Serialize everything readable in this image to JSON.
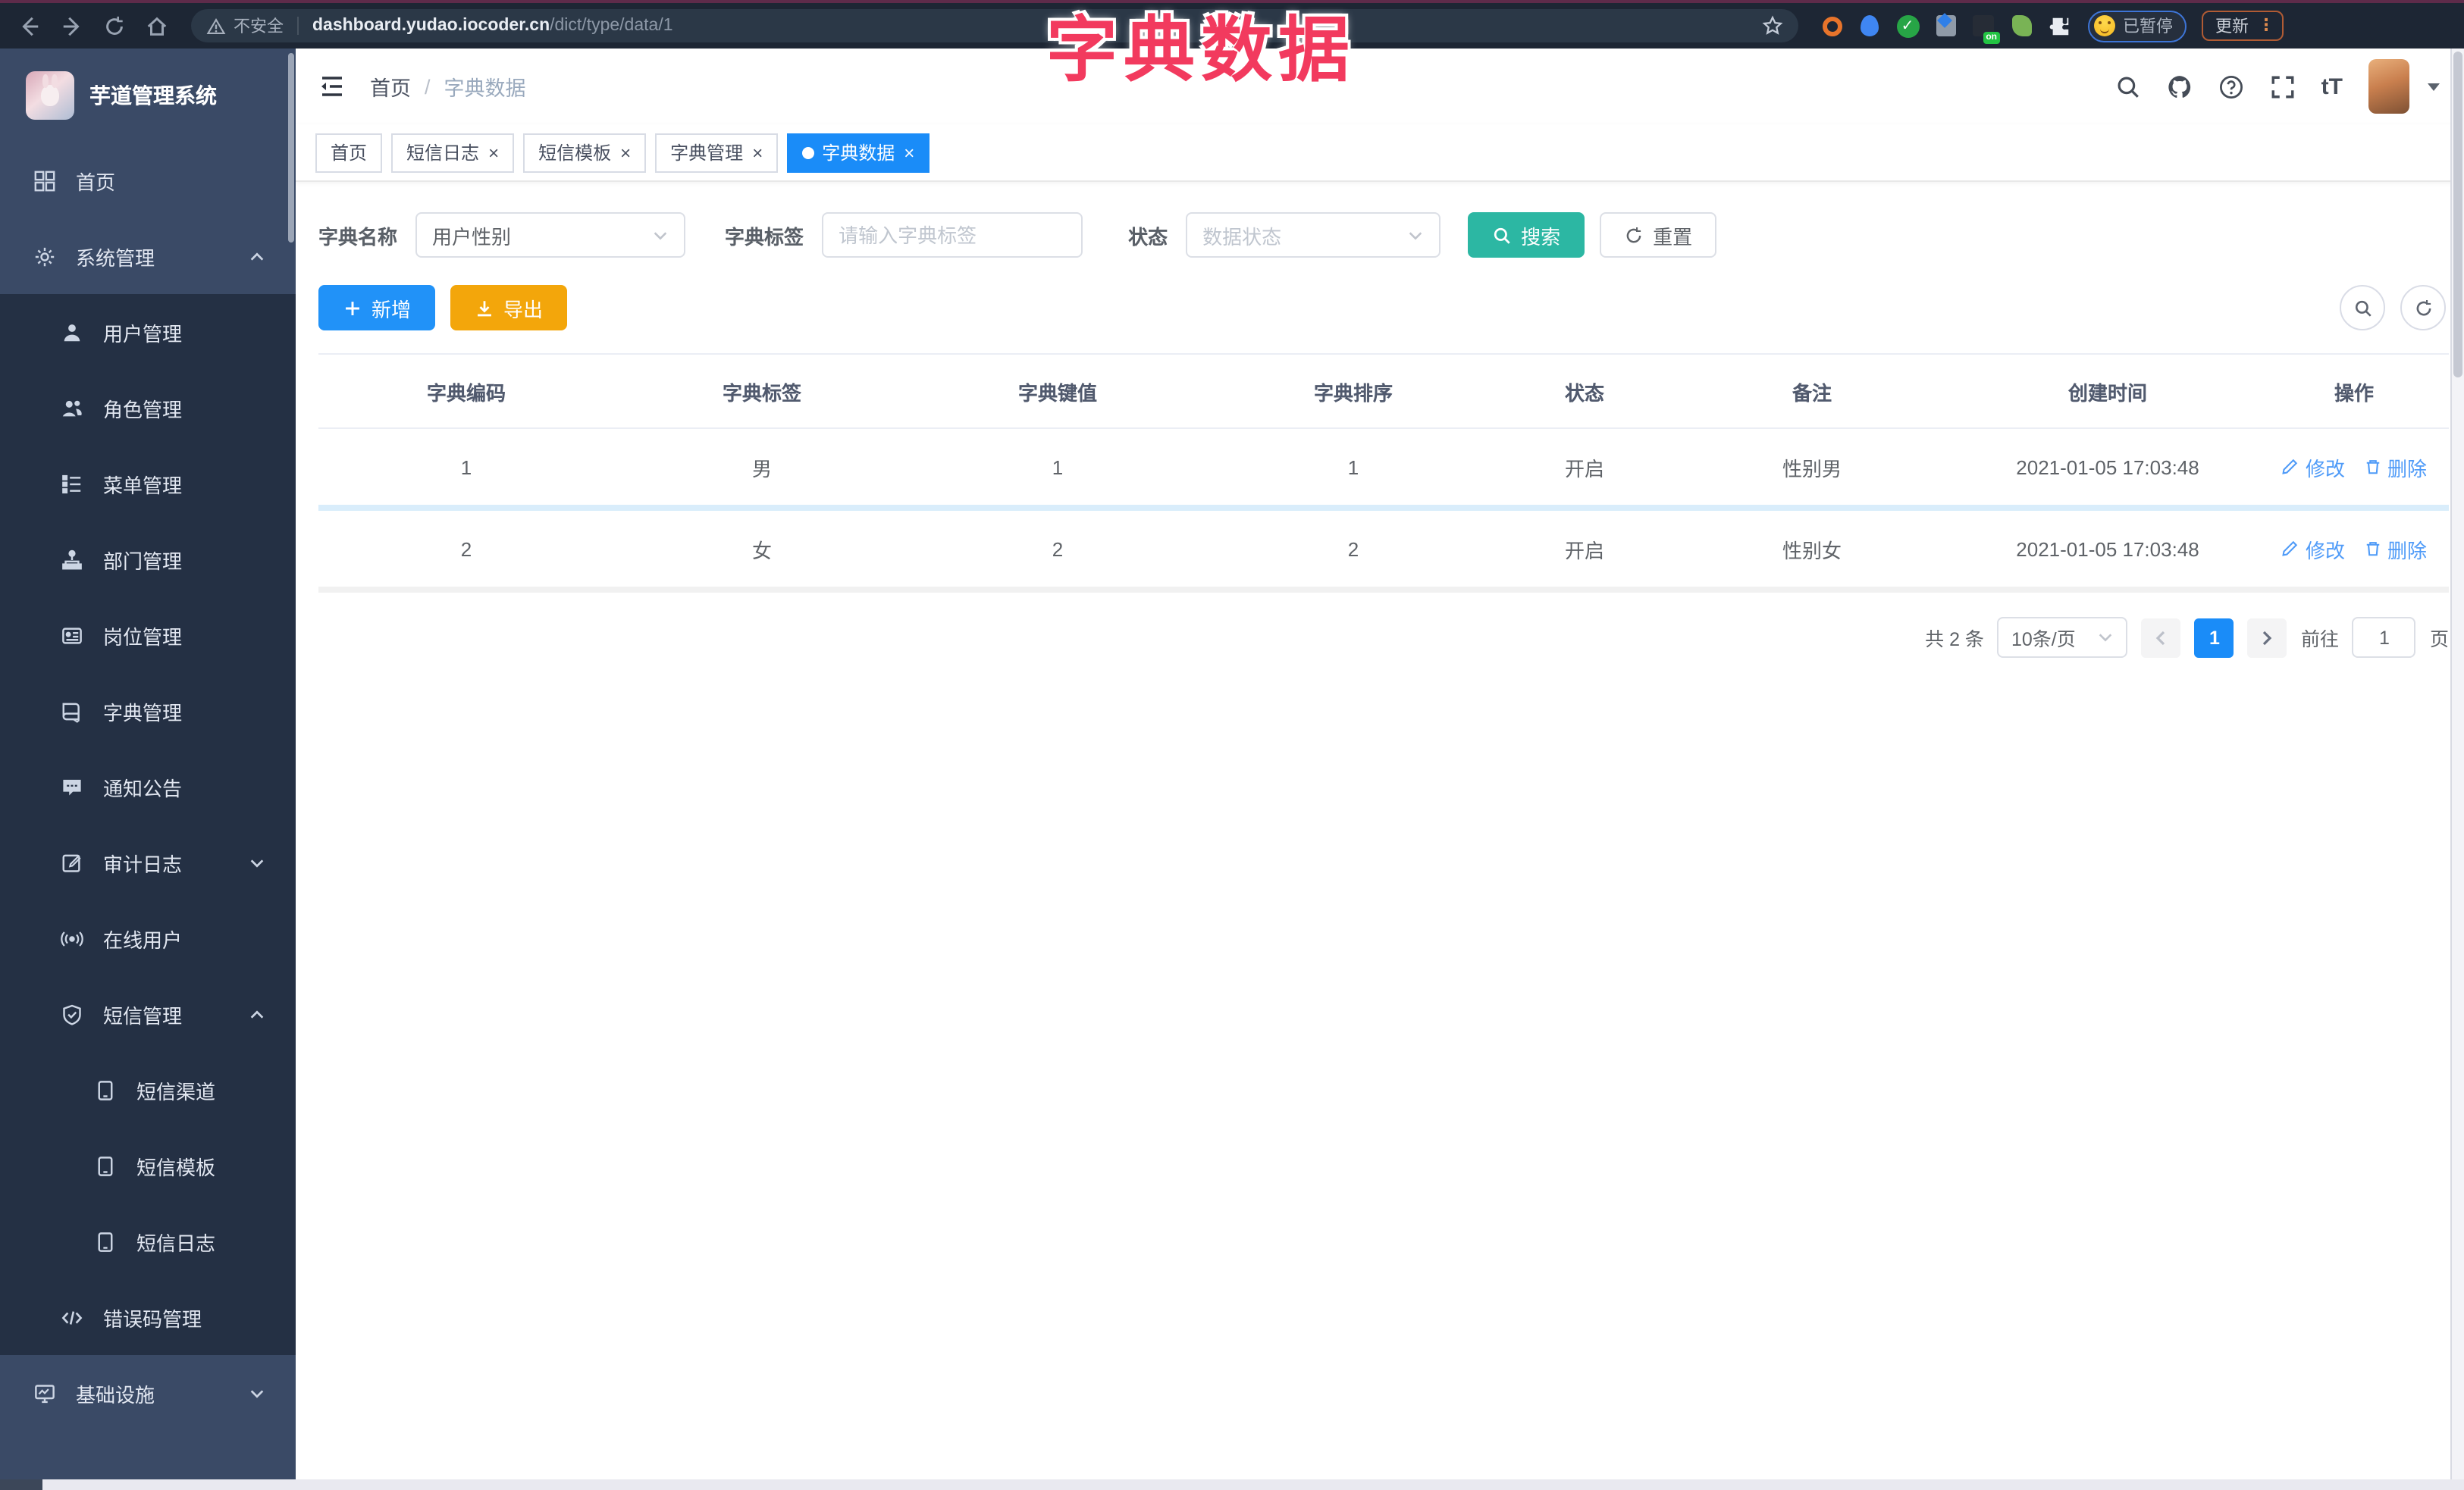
{
  "browser": {
    "security": "不安全",
    "domain": "dashboard.yudao.iocoder.cn",
    "path": "/dict/type/data/1",
    "on_badge": "on",
    "paused": "已暂停",
    "update": "更新"
  },
  "annotation": {
    "title": "字典数据"
  },
  "sidebar": {
    "title": "芋道管理系统",
    "items": [
      {
        "label": "首页"
      },
      {
        "label": "系统管理"
      },
      {
        "label": "用户管理"
      },
      {
        "label": "角色管理"
      },
      {
        "label": "菜单管理"
      },
      {
        "label": "部门管理"
      },
      {
        "label": "岗位管理"
      },
      {
        "label": "字典管理"
      },
      {
        "label": "通知公告"
      },
      {
        "label": "审计日志"
      },
      {
        "label": "在线用户"
      },
      {
        "label": "短信管理"
      },
      {
        "label": "短信渠道"
      },
      {
        "label": "短信模板"
      },
      {
        "label": "短信日志"
      },
      {
        "label": "错误码管理"
      },
      {
        "label": "基础设施"
      }
    ]
  },
  "navbar": {
    "breadcrumb_home": "首页",
    "breadcrumb_sep": "/",
    "breadcrumb_current": "字典数据"
  },
  "tabs": [
    {
      "label": "首页"
    },
    {
      "label": "短信日志"
    },
    {
      "label": "短信模板"
    },
    {
      "label": "字典管理"
    },
    {
      "label": "字典数据"
    }
  ],
  "ui": {
    "close_glyph": "×",
    "text_size_glyph": "tT"
  },
  "filter": {
    "name_label": "字典名称",
    "name_value": "用户性别",
    "tag_label": "字典标签",
    "tag_placeholder": "请输入字典标签",
    "status_label": "状态",
    "status_placeholder": "数据状态",
    "search_label": "搜索",
    "reset_label": "重置"
  },
  "toolbar": {
    "add_label": "新增",
    "export_label": "导出"
  },
  "table": {
    "headers": [
      "字典编码",
      "字典标签",
      "字典键值",
      "字典排序",
      "状态",
      "备注",
      "创建时间",
      "操作"
    ],
    "rows": [
      {
        "code": "1",
        "label": "男",
        "value": "1",
        "sort": "1",
        "status": "开启",
        "remark": "性别男",
        "created": "2021-01-05 17:03:48"
      },
      {
        "code": "2",
        "label": "女",
        "value": "2",
        "sort": "2",
        "status": "开启",
        "remark": "性别女",
        "created": "2021-01-05 17:03:48"
      }
    ],
    "edit_label": "修改",
    "delete_label": "删除"
  },
  "pagination": {
    "total": "共 2 条",
    "page_size": "10条/页",
    "current_page": "1",
    "goto_label": "前往",
    "goto_value": "1",
    "unit_label": "页"
  },
  "colors": {
    "primary": "#2192f8",
    "tab_active": "#1a8cf8",
    "success_teal": "#2cb7a3",
    "warning": "#f3a60b",
    "annotation_pink": "#f23a5e"
  }
}
